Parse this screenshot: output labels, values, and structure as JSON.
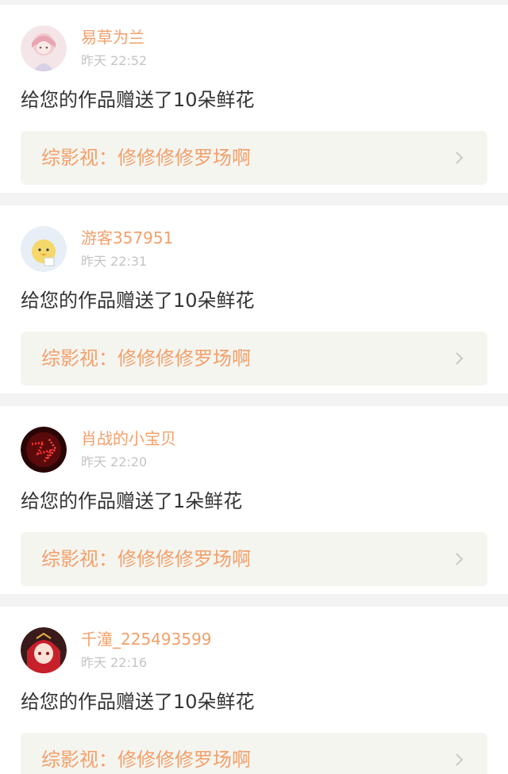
{
  "notifications": [
    {
      "username": "易草为兰",
      "time": "昨天 22:52",
      "message": "给您的作品赠送了10朵鲜花",
      "work_link": "综影视：修修修修罗场啊",
      "avatar": "avatar-anime-girl-pink"
    },
    {
      "username": "游客357951",
      "time": "昨天 22:31",
      "message": "给您的作品赠送了10朵鲜花",
      "work_link": "综影视：修修修修罗场啊",
      "avatar": "avatar-yellow-chick"
    },
    {
      "username": "肖战的小宝贝",
      "time": "昨天 22:20",
      "message": "给您的作品赠送了1朵鲜花",
      "work_link": "综影视：修修修修罗场啊",
      "avatar": "avatar-red-neon"
    },
    {
      "username": "千潼_225493599",
      "time": "昨天 22:16",
      "message": "给您的作品赠送了10朵鲜花",
      "work_link": "综影视：修修修修罗场啊",
      "avatar": "avatar-anime-red-hair"
    }
  ],
  "colors": {
    "accent": "#f2a06b",
    "muted": "#c4c4c4",
    "text": "#333333",
    "link_bg": "#f5f5f0",
    "page_bg": "#f3f3f3"
  },
  "icons": {
    "chevron": "chevron-right-icon"
  }
}
